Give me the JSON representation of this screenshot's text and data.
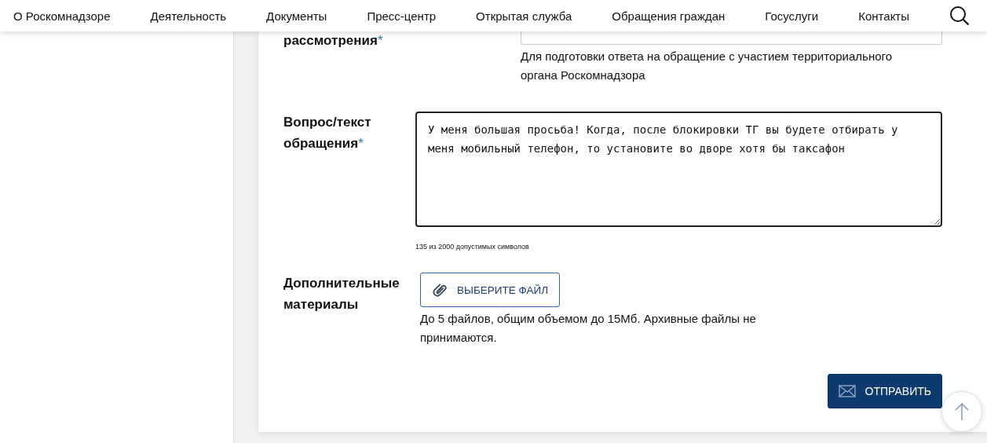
{
  "nav": {
    "items": [
      "О Роскомнадзоре",
      "Деятельность",
      "Документы",
      "Пресс-центр",
      "Открытая служба",
      "Обращения граждан",
      "Госуслуги",
      "Контакты"
    ]
  },
  "form": {
    "fields": [
      {
        "kind": "select",
        "label": "рассмотрения",
        "required_mark": "*",
        "help": "Для подготовки ответа на обращение с участием территориального органа Роскомнадзора"
      },
      {
        "kind": "textarea",
        "label": "Вопрос/текст обращения",
        "required_mark": "*",
        "value": "У меня большая просьба! Когда, после блокировки ТГ вы будете отбирать у меня мобильный телефон, то установите во дворе хотя бы таксафон",
        "counter": "135 из 2000 допустимых символов"
      },
      {
        "kind": "file",
        "label": "Дополнительные материалы",
        "button": "ВЫБЕРИТЕ ФАЙЛ",
        "help": "До 5 файлов, общим объемом до 15Мб. Архивные файлы не принимаются."
      }
    ],
    "submit": "ОТПРАВИТЬ"
  }
}
